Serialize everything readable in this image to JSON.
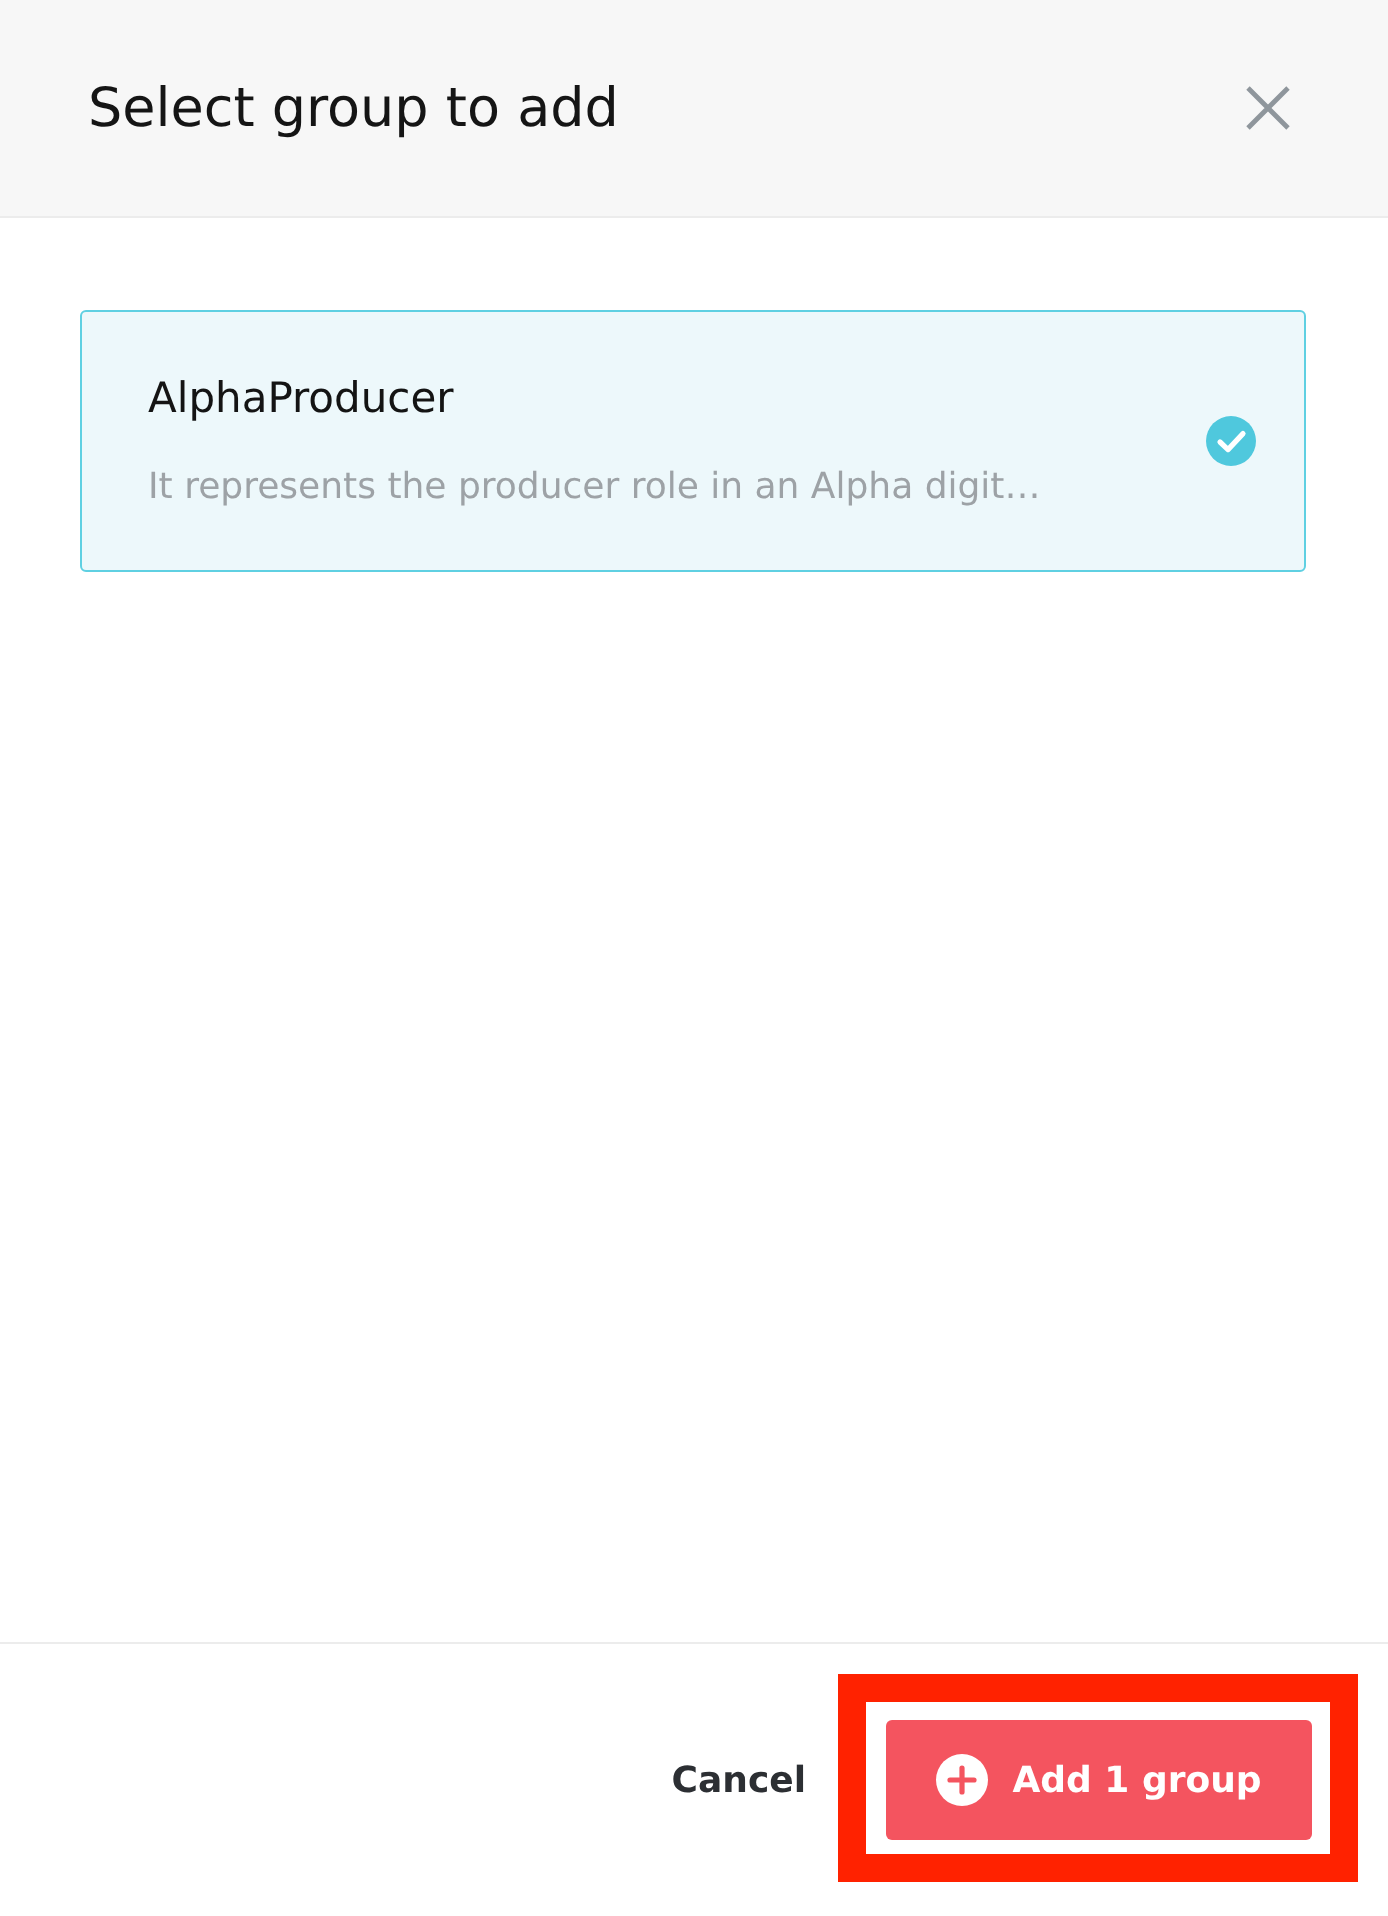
{
  "dialog": {
    "title": "Select group to add"
  },
  "groups": [
    {
      "name": "AlphaProducer",
      "description": "It represents the producer role in an Alpha digit…",
      "selected": true
    }
  ],
  "footer": {
    "cancel": "Cancel",
    "confirm": {
      "label": "Add 1 group",
      "highlighted": true
    }
  }
}
